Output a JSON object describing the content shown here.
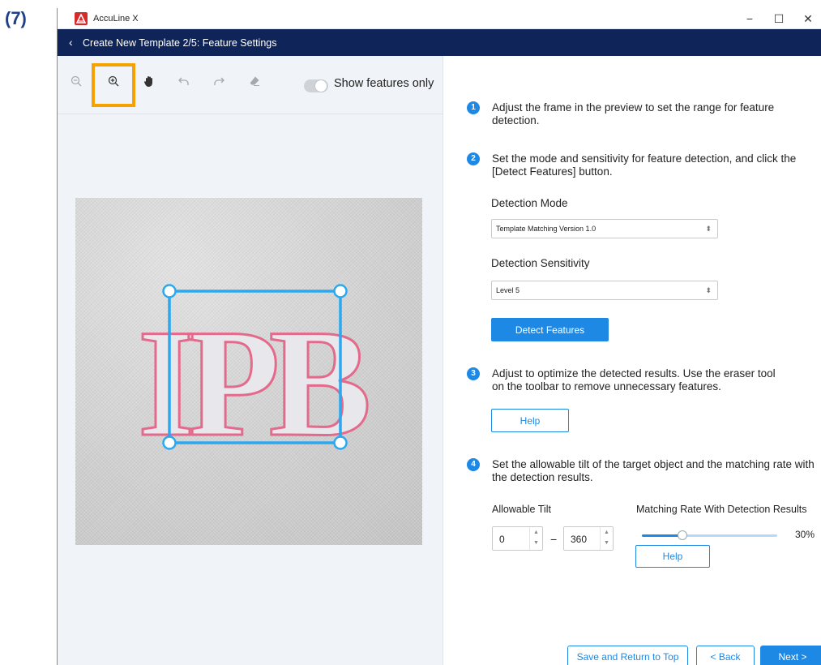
{
  "step_marker": "(7)",
  "window": {
    "app_title": "AccuLine X",
    "controls": {
      "minimize": "−",
      "maximize": "☐",
      "close": "✕"
    }
  },
  "nav": {
    "back_icon": "‹",
    "title": "Create New Template 2/5: Feature Settings"
  },
  "toolbar": {
    "tools": [
      "zoom-out-icon",
      "zoom-in-icon",
      "hand-icon",
      "undo-icon",
      "redo-icon",
      "eraser-icon"
    ],
    "highlighted_tool": "zoom-in-icon",
    "highlight_color": "#f5a100",
    "toggle_label": "Show features only",
    "toggle_on": false
  },
  "preview": {
    "logo_text": "IPB",
    "frame_color": "#2aa8f0"
  },
  "steps": [
    {
      "num": "1",
      "text": "Adjust the frame in the preview to set the range for feature detection."
    },
    {
      "num": "2",
      "text": "Set the mode and sensitivity for feature detection, and click the [Detect Features] button."
    },
    {
      "num": "3",
      "text": "Adjust to optimize the detected results. Use the eraser tool on the toolbar to remove unnecessary features."
    },
    {
      "num": "4",
      "text": "Set the allowable tilt of the target object and the matching rate with the detection results."
    }
  ],
  "detection_mode": {
    "label": "Detection Mode",
    "value": "Template Matching Version 1.0"
  },
  "detection_sensitivity": {
    "label": "Detection Sensitivity",
    "value": "Level 5"
  },
  "buttons": {
    "detect_features": "Detect Features",
    "help": "Help",
    "help2": "Help",
    "save_return": "Save and Return to Top",
    "back": "< Back",
    "next": "Next >"
  },
  "tilt": {
    "label": "Allowable Tilt",
    "min": "0",
    "dash": "−",
    "max": "360"
  },
  "matching": {
    "label": "Matching Rate With Detection Results",
    "percent": 30,
    "percent_text": "30%"
  },
  "colors": {
    "nav_bg": "#0f2458",
    "accent": "#1e88e5"
  }
}
